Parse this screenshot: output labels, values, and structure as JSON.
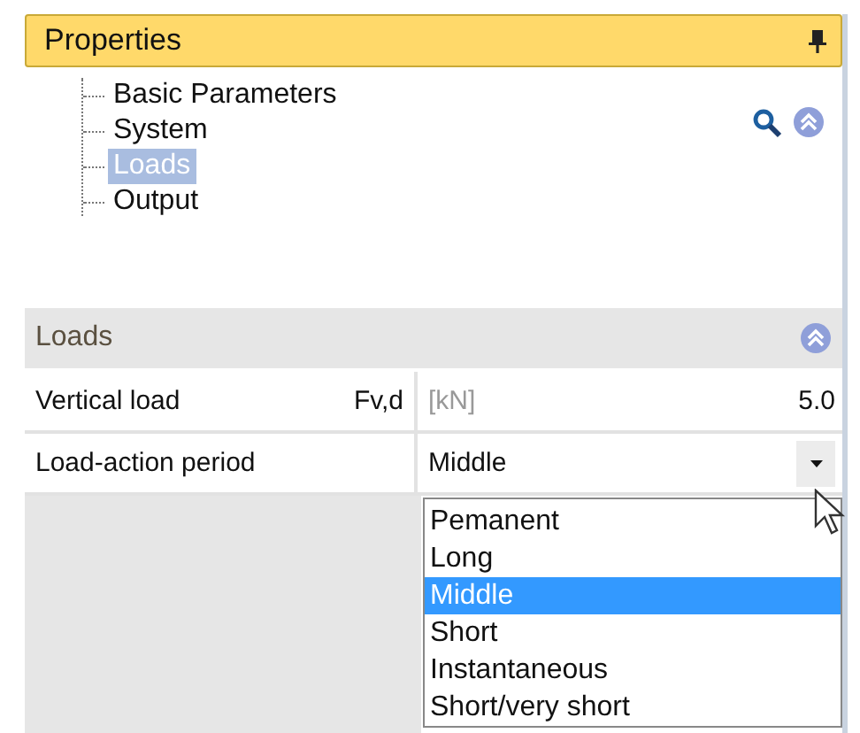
{
  "panel": {
    "title": "Properties",
    "pinned": true
  },
  "tree": {
    "items": [
      {
        "label": "Basic Parameters",
        "selected": false
      },
      {
        "label": "System",
        "selected": false
      },
      {
        "label": "Loads",
        "selected": true
      },
      {
        "label": "Output",
        "selected": false
      }
    ]
  },
  "section": {
    "title": "Loads",
    "expanded": true,
    "rows": [
      {
        "kind": "value",
        "label": "Vertical load",
        "symbol": "Fv,d",
        "unit": "[kN]",
        "value": "5.0"
      },
      {
        "kind": "dropdown",
        "label": "Load-action period",
        "value": "Middle",
        "open": true,
        "options": [
          {
            "label": "Pemanent",
            "selected": false
          },
          {
            "label": "Long",
            "selected": false
          },
          {
            "label": "Middle",
            "selected": true
          },
          {
            "label": "Short",
            "selected": false
          },
          {
            "label": "Instantaneous",
            "selected": false
          },
          {
            "label": "Short/very short",
            "selected": false
          }
        ]
      }
    ]
  }
}
